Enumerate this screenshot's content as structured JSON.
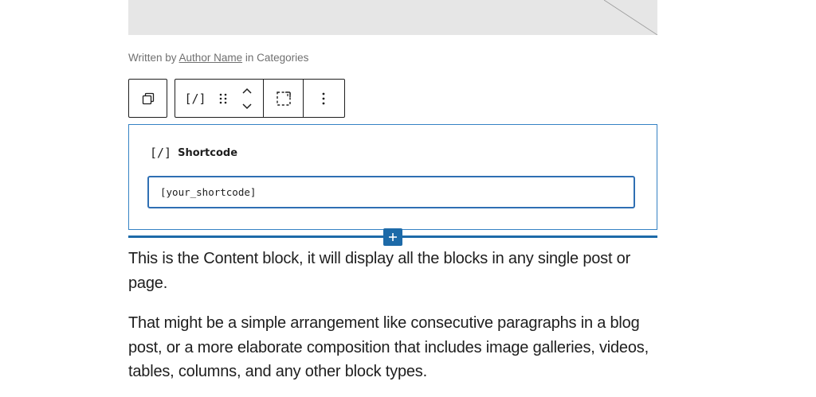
{
  "byline": {
    "prefix": "Written by",
    "author": "Author Name",
    "middle": "in",
    "categories": "Categories"
  },
  "toolbar": {
    "shortcode_glyph": "[/]"
  },
  "shortcode_block": {
    "glyph": "[/]",
    "title": "Shortcode",
    "value": "[your_shortcode]"
  },
  "content": {
    "paragraph_1": "This is the Content block, it will display all the blocks in any single post or page.",
    "paragraph_2": "That might be a simple arrangement like consecutive paragraphs in a blog post, or a more elaborate composition that includes image galleries, videos, tables, columns, and any other block types."
  },
  "icons": {
    "parent": "parent-block-icon",
    "drag": "drag-handle-icon",
    "move_up": "chevron-up-icon",
    "move_down": "chevron-down-icon",
    "transform": "group-select-icon",
    "options": "more-options-icon",
    "inserter": "plus-icon"
  },
  "colors": {
    "accent": "#1d6aa8",
    "block_outline": "#3582c4",
    "text": "#1e1e1e",
    "meta_text": "#707070",
    "placeholder_bg": "#e6e6e6"
  }
}
